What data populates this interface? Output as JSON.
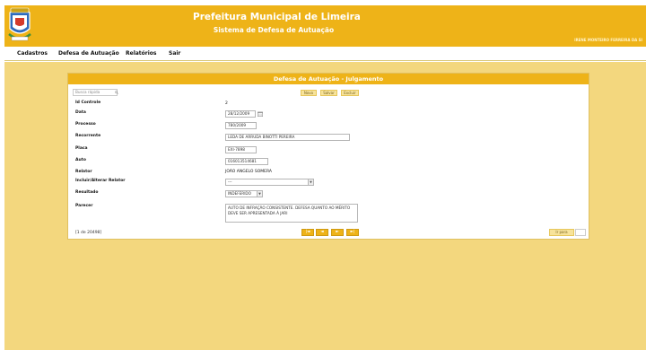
{
  "header": {
    "title": "Prefeitura Municipal de Limeira",
    "subtitle": "Sistema de Defesa de Autuação",
    "user": "IRENE MONTEIRO FERREIRA DA SI"
  },
  "menu": {
    "items": [
      "Cadastros",
      "Defesa de Autuação",
      "Relatórios",
      "Sair"
    ]
  },
  "panel": {
    "title": "Defesa de Autuação - Julgamento",
    "search_placeholder": "Busca rápida",
    "buttons": {
      "novo": "Novo",
      "salvar": "Salvar",
      "excluir": "Excluir"
    }
  },
  "form": {
    "id_controle": {
      "label": "Id Controle",
      "value": "2"
    },
    "data": {
      "label": "Data",
      "value": "28/12/2009"
    },
    "processo": {
      "label": "Processo",
      "value": "780/2009"
    },
    "recorrente": {
      "label": "Recorrente",
      "value": "LEDA DE ARRUDA BINOTTI PEREIRA"
    },
    "placa": {
      "label": "Placa",
      "value": "EXI-7898"
    },
    "auto": {
      "label": "Auto",
      "value": "016013514681"
    },
    "relator": {
      "label": "Relator",
      "value": "JOÃO ANGELO SOMERA"
    },
    "incluir_relator": {
      "label": "Incluir/Alterar Relator",
      "value": "---"
    },
    "resultado": {
      "label": "Resultado",
      "value": "INDEFERIDO"
    },
    "parecer": {
      "label": "Parecer",
      "value": "AUTO DE INFRAÇÃO CONSISTENTE. DEFESA QUANTO AO MÉRITO DEVE SER APRESENTADA À JARI"
    }
  },
  "footer": {
    "record_count": "[1 de 20498]",
    "nav": {
      "first": "|◄",
      "prev": "◄",
      "next": "►",
      "last": "►|"
    },
    "goto_label": "Ir para"
  },
  "colors": {
    "header_bg": "#eeb318",
    "content_bg": "#f3d77e",
    "accent": "#eeb318"
  }
}
